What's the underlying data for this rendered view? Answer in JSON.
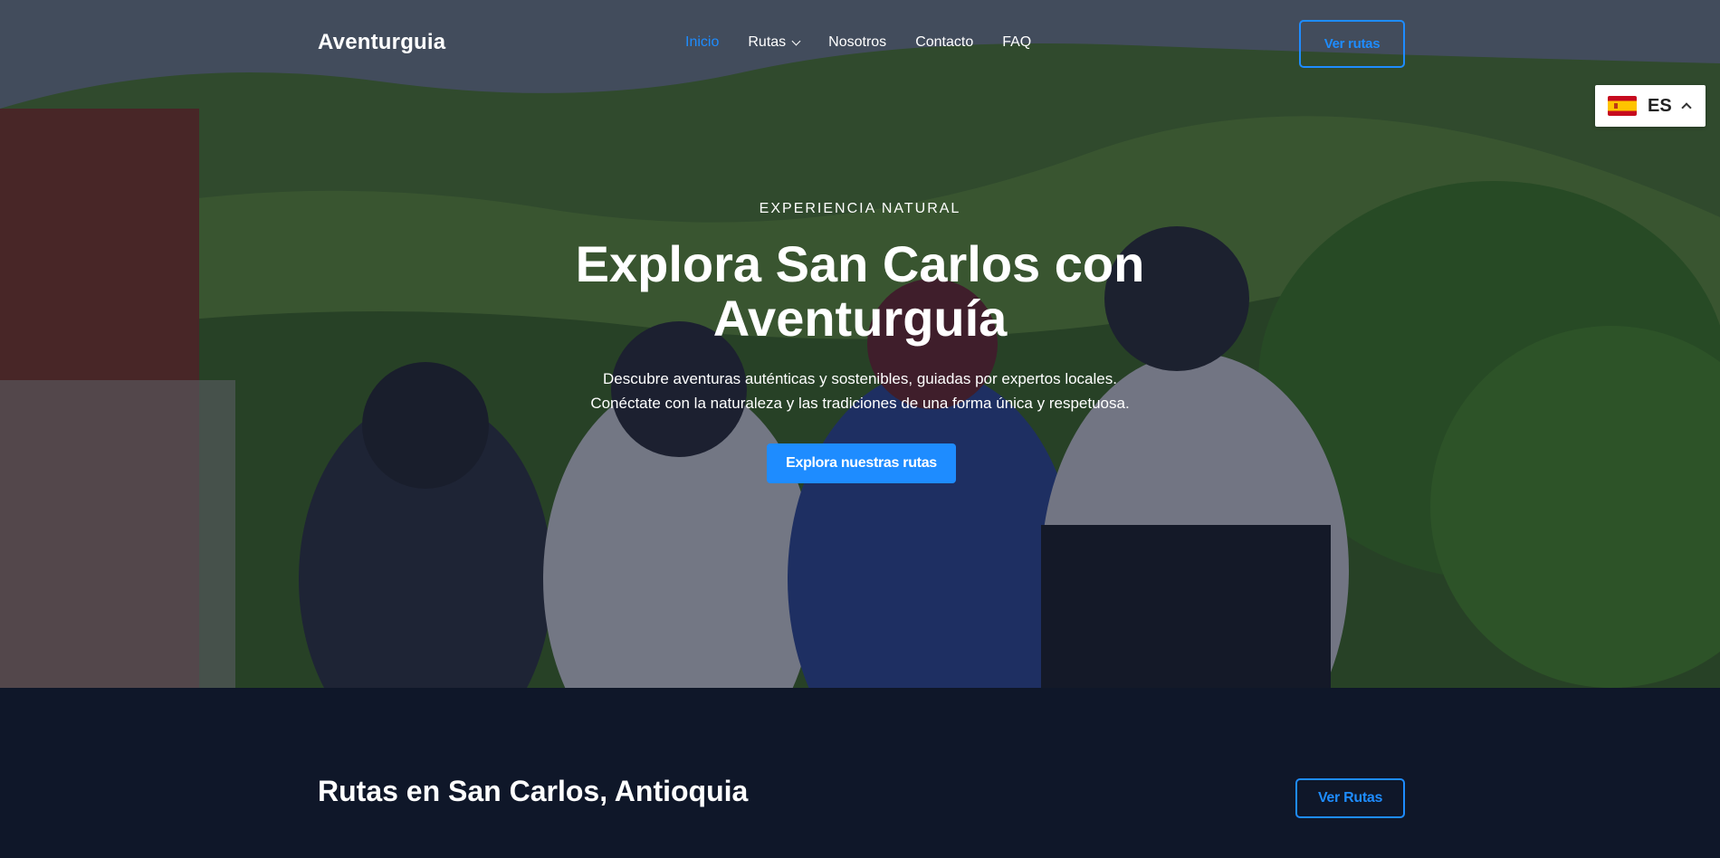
{
  "nav": {
    "brand": "Aventurguia",
    "menu": [
      {
        "label": "Inicio",
        "active": true
      },
      {
        "label": "Rutas",
        "has_dropdown": true
      },
      {
        "label": "Nosotros"
      },
      {
        "label": "Contacto"
      },
      {
        "label": "FAQ"
      }
    ],
    "cta_label": "Ver rutas"
  },
  "language": {
    "code": "ES",
    "flag_icon": "spain-flag-icon"
  },
  "hero": {
    "eyebrow": "EXPERIENCIA NATURAL",
    "title": "Explora San Carlos con Aventurguía",
    "description_line1": "Descubre aventuras auténticas y sostenibles, guiadas por expertos locales.",
    "description_line2": "Conéctate con la naturaleza y las tradiciones de una forma única y respetuosa.",
    "cta_label": "Explora nuestras rutas"
  },
  "routes_section": {
    "title": "Rutas en San Carlos, Antioquia",
    "cta_label": "Ver Rutas"
  },
  "colors": {
    "accent": "#1e8cff",
    "section_bg": "#0f1729"
  }
}
